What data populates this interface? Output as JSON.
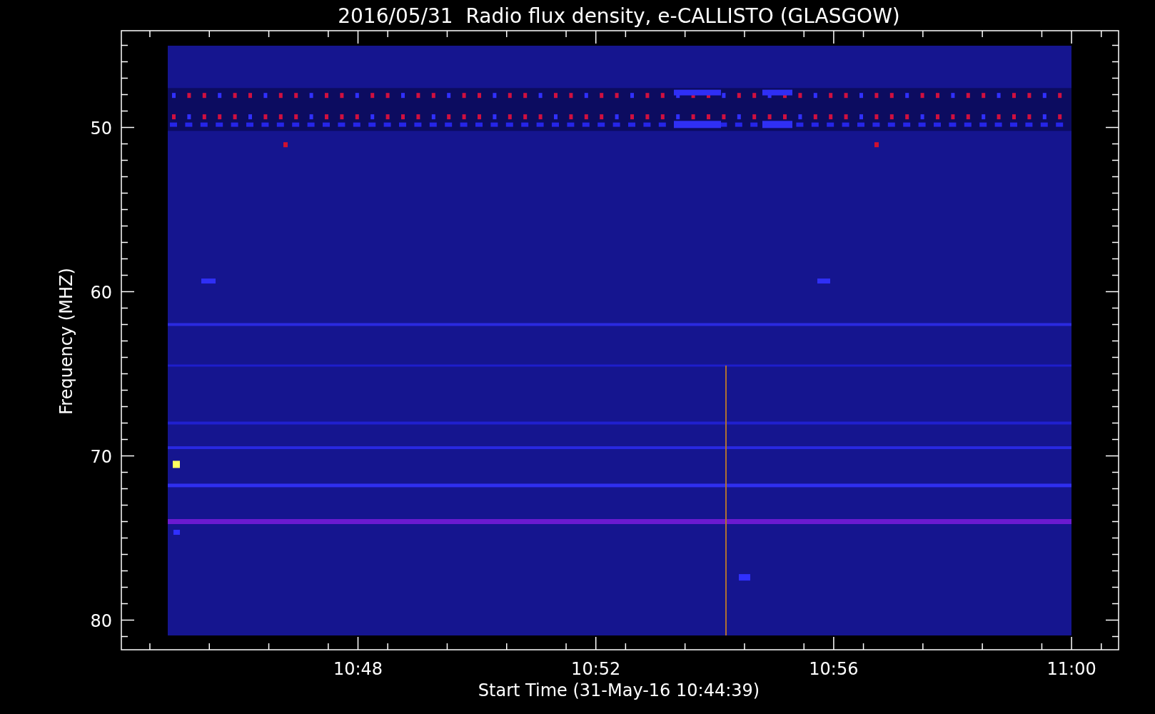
{
  "plot": {
    "title": "2016/05/31  Radio flux density, e-CALLISTO (GLASGOW)",
    "ylabel": "Frequency (MHZ)",
    "xlabel": "Start Time (31-May-16 10:44:39)",
    "y_ticks": [
      "50",
      "60",
      "70",
      "80"
    ],
    "x_ticks": [
      "10:48",
      "10:52",
      "10:56",
      "11:00"
    ]
  }
}
